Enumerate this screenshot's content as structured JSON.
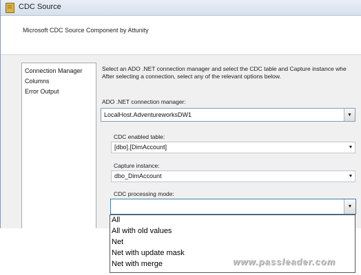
{
  "window": {
    "title": "CDC Source",
    "subtitle": "Microsoft CDC Source Component by Attunity"
  },
  "nav": {
    "items": [
      "Connection Manager",
      "Columns",
      "Error Output"
    ]
  },
  "main": {
    "intro_line1": "Select an ADO .NET connection manager and select the CDC table and Capture instance whe",
    "intro_line2": "After selecting a connection, select any of the relevant options below.",
    "connection_label": "ADO .NET connection manager:",
    "connection_value": "LocalHost.AdventureworksDW1",
    "table_label": "CDC enabled table:",
    "table_value": "[dbo].[DimAccount]",
    "capture_label": "Capture instance:",
    "capture_value": "dbo_DimAccount",
    "mode_label": "CDC processing mode:",
    "mode_value": ""
  },
  "dropdown": {
    "options": [
      "All",
      "All with old values",
      "Net",
      "Net with update mask",
      "Net with merge"
    ]
  },
  "watermark": "www.passleader.com",
  "icons": {
    "app": "app-icon",
    "dropdown": "chevron-down-icon"
  }
}
